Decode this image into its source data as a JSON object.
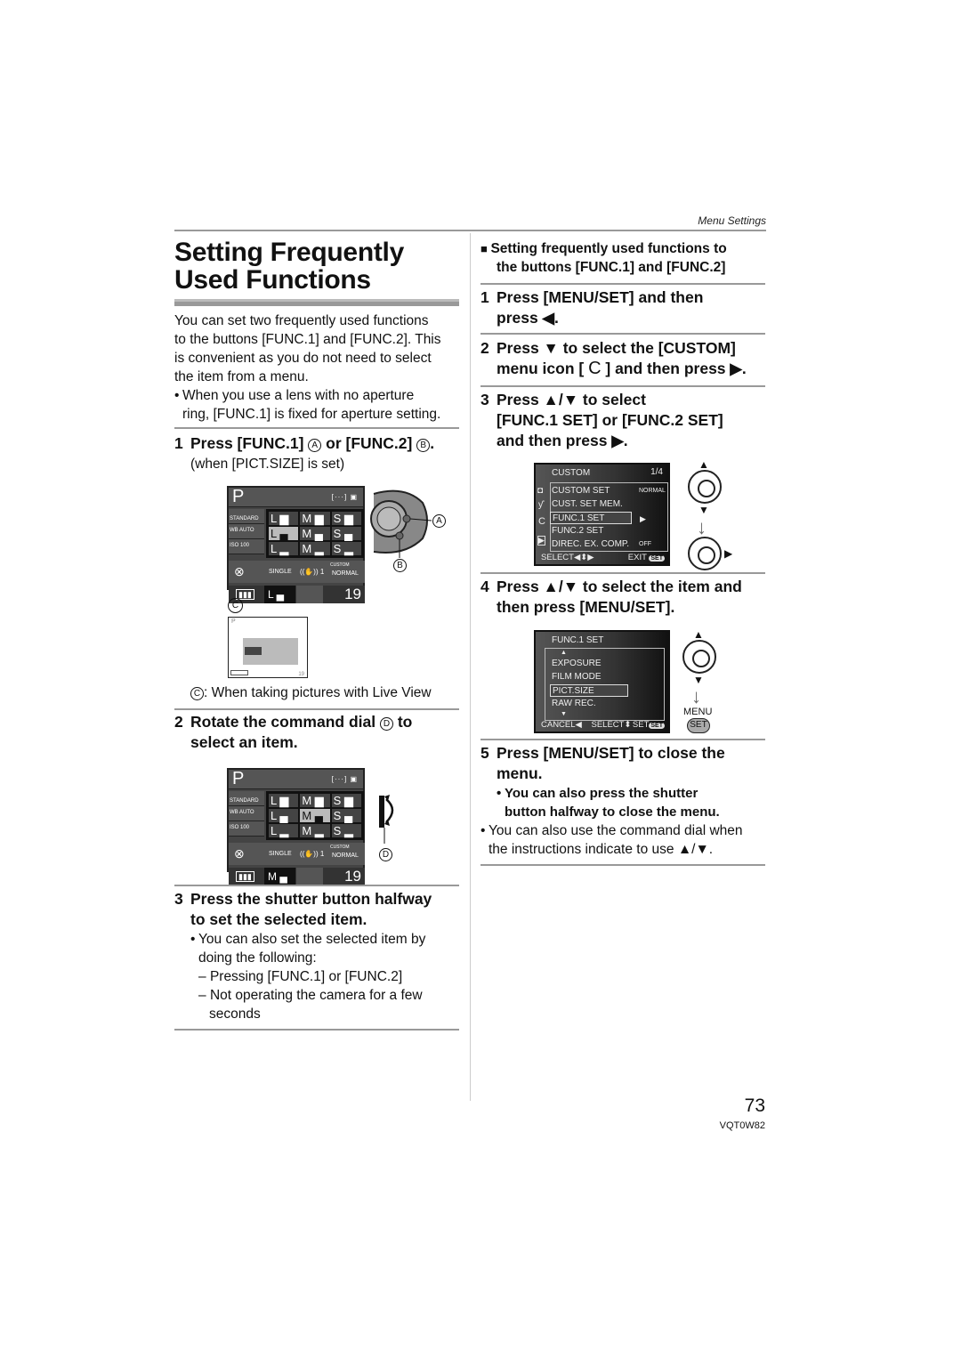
{
  "header": {
    "section": "Menu Settings"
  },
  "title": {
    "line1": "Setting Frequently",
    "line2": "Used Functions"
  },
  "intro": {
    "paragraph": [
      "You can set two frequently used functions",
      "to the buttons [FUNC.1] and [FUNC.2]. This",
      "is convenient as you do not need to select",
      "the item from a menu."
    ],
    "bullet": [
      "When you use a lens with no aperture",
      "ring, [FUNC.1] is fixed for aperture setting."
    ]
  },
  "left_steps": {
    "step1": {
      "num": "1",
      "text_a": "Press [FUNC.1] ",
      "label_a": "A",
      "text_b": " or [FUNC.2] ",
      "label_b": "B",
      "text_end": ".",
      "sub": "(when [PICT.SIZE] is set)"
    },
    "callout_c": "C",
    "caption_c_label": "C",
    "caption_c": ":  When taking pictures with Live View",
    "step2": {
      "num": "2",
      "line1_a": "Rotate the command dial ",
      "label_d": "D",
      "line1_b": " to",
      "line2": "select an item."
    },
    "step3": {
      "num": "3",
      "line1": "Press the shutter button halfway",
      "line2": "to set the selected item.",
      "bullet1": "You can also set the selected item by",
      "bullet1b": "doing the following:",
      "dash1": "Pressing [FUNC.1] or [FUNC.2]",
      "dash2a": "Not operating the camera for a few",
      "dash2b": "seconds"
    }
  },
  "lcd1": {
    "mode": "P",
    "af": "[···] ▣",
    "left": [
      "STANDARD",
      "WB AUTO",
      "ISO 100"
    ],
    "sizes": [
      "L ▆",
      "M ▆",
      "S ▆",
      "L ▄",
      "M ▄",
      "S ▄",
      "L ▂",
      "M ▂",
      "S ▂"
    ],
    "selected_index": 3,
    "drive": "SINGLE",
    "stab": "((✋)) 1",
    "custom": "CUSTOM",
    "quality": "NORMAL",
    "battery": "▮▮▮",
    "current": "L ▄",
    "count": "19"
  },
  "lcd2": {
    "mode": "P",
    "selected_index": 4,
    "current": "M ▄",
    "count": "19"
  },
  "camera_labels": {
    "a": "A",
    "b": "B",
    "d": "D"
  },
  "right": {
    "heading": "Setting frequently used functions to",
    "heading2": "the buttons [FUNC.1] and [FUNC.2]",
    "step1": {
      "num": "1",
      "line1": "Press [MENU/SET] and then",
      "line2": "press ◀."
    },
    "step2": {
      "num": "2",
      "line1": "Press ▼ to select the [CUSTOM]",
      "line2a": "menu icon [ ",
      "icon": "C",
      "line2b": " ] and then press ▶."
    },
    "step3": {
      "num": "3",
      "line1": "Press ▲/▼ to select",
      "line2": "[FUNC.1 SET] or [FUNC.2 SET]",
      "line3": "and then press ▶."
    },
    "step4": {
      "num": "4",
      "line1": "Press ▲/▼ to select the item and",
      "line2": "then press [MENU/SET]."
    },
    "step5": {
      "num": "5",
      "line1": "Press [MENU/SET] to close the",
      "line2": "menu.",
      "bold_bullet1": "You can also press the shutter",
      "bold_bullet2": "button halfway to close the menu.",
      "bullet1": "You can also use the command dial when",
      "bullet2": "the instructions indicate to use ▲/▼."
    }
  },
  "menu1": {
    "title": "CUSTOM",
    "page": "1/4",
    "items": [
      {
        "label": "CUSTOM SET",
        "value": "NORMAL"
      },
      {
        "label": "CUST. SET MEM.",
        "value": ""
      },
      {
        "label": "FUNC.1 SET",
        "value": "▶"
      },
      {
        "label": "FUNC.2 SET",
        "value": ""
      },
      {
        "label": "DIREC. EX. COMP.",
        "value": "OFF"
      }
    ],
    "selected_index": 2,
    "select": "SELECT◀⬍▶",
    "exit": "EXIT",
    "exit_badge": "SET"
  },
  "menu2": {
    "title": "FUNC.1 SET",
    "items": [
      "EXPOSURE",
      "FILM MODE",
      "PICT.SIZE",
      "RAW REC."
    ],
    "selected_index": 2,
    "cancel": "CANCEL◀",
    "select": "SELECT⬍",
    "set": "SET",
    "set_badge": "SET"
  },
  "menu_button": {
    "label": "MENU",
    "badge": "SET"
  },
  "footer": {
    "page_number": "73",
    "code": "VQT0W82"
  }
}
